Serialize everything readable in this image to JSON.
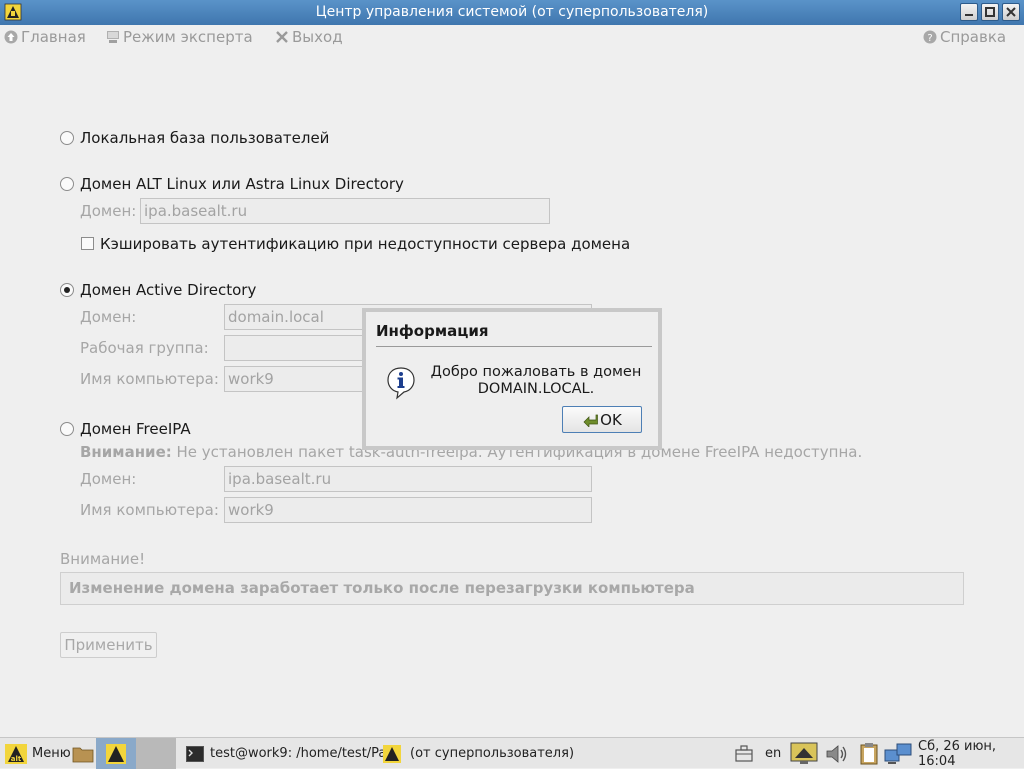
{
  "window": {
    "title": "Центр управления системой (от суперпользователя)"
  },
  "toolbar": {
    "home": "Главная",
    "expert": "Режим эксперта",
    "exit": "Выход",
    "help": "Справка"
  },
  "options": {
    "local": {
      "label": "Локальная база пользователей",
      "selected": false
    },
    "alt": {
      "label": "Домен ALT Linux или Astra Linux Directory",
      "selected": false,
      "domain_label": "Домен:",
      "domain_value": "ipa.basealt.ru",
      "cache_label": "Кэшировать аутентификацию при недоступности сервера домена",
      "cache_checked": false
    },
    "ad": {
      "label": "Домен Active Directory",
      "selected": true,
      "domain_label": "Домен:",
      "domain_value": "domain.local",
      "workgroup_label": "Рабочая группа:",
      "workgroup_value": "",
      "computer_label": "Имя компьютера:",
      "computer_value": "work9"
    },
    "freeipa": {
      "label": "Домен FreeIPA",
      "selected": false,
      "warning_bold": "Внимание:",
      "warning_text": "Не установлен пакет task-auth-freeipa. Аутентификация в домене FreeIPA недоступна.",
      "domain_label": "Домен:",
      "domain_value": "ipa.basealt.ru",
      "computer_label": "Имя компьютера:",
      "computer_value": "work9"
    }
  },
  "notice": {
    "label": "Внимание!",
    "text": "Изменение домена заработает только после перезагрузки компьютера"
  },
  "apply_button": "Применить",
  "dialog": {
    "title": "Информация",
    "message_line1": "Добро пожаловать в домен",
    "message_line2": "DOMAIN.LOCAL.",
    "ok": "OK"
  },
  "taskbar": {
    "menu": "Меню",
    "task1": "test@work9: /home/test/Pa...",
    "task2": "(от суперпользователя)",
    "lang": "en",
    "clock": "Сб, 26 июн, 16:04"
  }
}
